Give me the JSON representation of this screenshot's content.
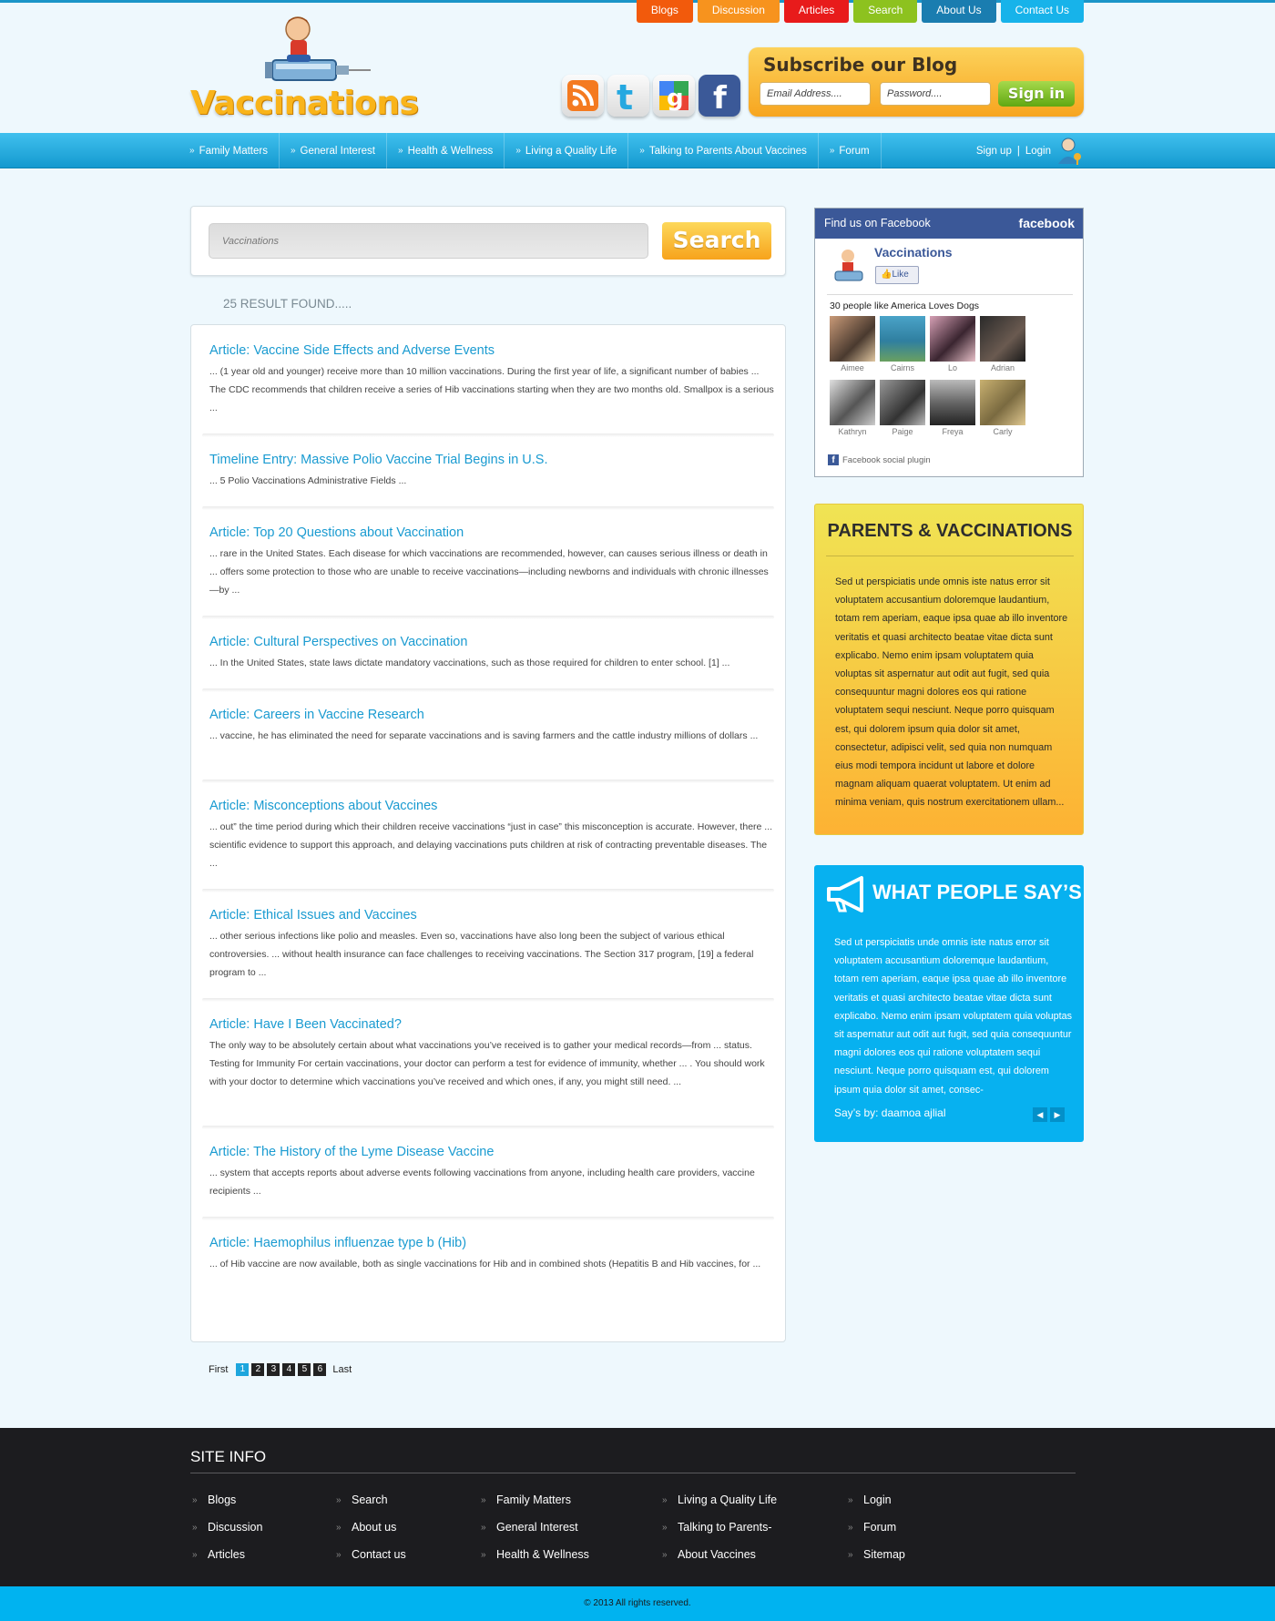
{
  "top_tabs": [
    {
      "label": "Blogs",
      "color": "#f25a0c"
    },
    {
      "label": "Discussion",
      "color": "#f7931e"
    },
    {
      "label": "Articles",
      "color": "#e81b1b"
    },
    {
      "label": "Search",
      "color": "#8dc21f"
    },
    {
      "label": "About Us",
      "color": "#1a7db0"
    },
    {
      "label": "Contact Us",
      "color": "#17b3ea"
    }
  ],
  "logo": {
    "text": "Vaccinations"
  },
  "social_icons": [
    "rss-icon",
    "twitter-icon",
    "google-icon",
    "facebook-icon"
  ],
  "subscribe": {
    "title": "Subscribe our Blog",
    "email_placeholder": "Email Address....",
    "password_placeholder": "Password....",
    "signin_label": "Sign in"
  },
  "nav": {
    "items": [
      "Family Matters",
      "General Interest",
      "Health & Wellness",
      "Living a Quality Life",
      "Talking to Parents About Vaccines",
      "Forum"
    ],
    "signup": "Sign up",
    "sep": "|",
    "login": "Login"
  },
  "search": {
    "value": "Vaccinations",
    "button": "Search"
  },
  "result_count": "25 RESULT FOUND.....",
  "results": [
    {
      "title": "Article: Vaccine Side Effects and Adverse Events",
      "snippet": "... (1 year old and younger) receive more than 10 million vaccinations. During the first year of life, a significant number of babies ... The CDC recommends that children receive a series of Hib vaccinations starting when they are two months old. Smallpox is a serious ..."
    },
    {
      "title": "Timeline Entry: Massive Polio Vaccine Trial Begins in U.S.",
      "snippet": "... 5 Polio Vaccinations Administrative Fields ..."
    },
    {
      "title": "Article: Top 20 Questions about Vaccination",
      "snippet": "... rare in the United States. Each disease for which vaccinations are recommended, however, can causes serious illness or death in ... offers some protection to those who are unable to receive vaccinations—including newborns and individuals with chronic illnesses—by ..."
    },
    {
      "title": "Article: Cultural Perspectives on Vaccination",
      "snippet": "... In the United States, state laws dictate mandatory vaccinations, such as those required for children to enter school. [1] ..."
    },
    {
      "title": "Article: Careers in Vaccine Research",
      "snippet": "... vaccine, he has eliminated the need for separate vaccinations and is saving farmers and the cattle industry millions of dollars ..."
    },
    {
      "title": "Article: Misconceptions about Vaccines",
      "snippet": "... out” the time period during which their children receive vaccinations “just in case” this misconception is accurate. However, there ... scientific evidence to support this approach, and delaying vaccinations puts children at risk of contracting preventable diseases. The ..."
    },
    {
      "title": "Article: Ethical Issues and Vaccines",
      "snippet": "... other serious infections like polio and measles. Even so, vaccinations have also long been the subject of various ethical controversies. ... without health insurance can face challenges to receiving vaccinations. The Section 317 program, [19] a federal program to ..."
    },
    {
      "title": "Article: Have I Been Vaccinated?",
      "snippet": "The only way to be absolutely certain about what vaccinations you’ve received is to gather your medical records—from ... status. Testing for Immunity For certain vaccinations, your doctor can perform a test for evidence of immunity, whether ... . You should work with your doctor to determine which vaccinations you’ve received and which ones, if any, you might still need. ..."
    },
    {
      "title": "Article: The History of the Lyme Disease Vaccine",
      "snippet": "... system that accepts reports about adverse events following vaccinations from anyone, including health care providers, vaccine recipients ..."
    },
    {
      "title": "Article: Haemophilus influenzae type b (Hib)",
      "snippet": "... of Hib vaccine are now available, both as single vaccinations for Hib and in combined shots (Hepatitis B and Hib vaccines, for ..."
    }
  ],
  "pagination": {
    "first": "First",
    "pages": [
      "1",
      "2",
      "3",
      "4",
      "5",
      "6"
    ],
    "current": "1",
    "last": "Last"
  },
  "facebook": {
    "header": "Find us on Facebook",
    "logo_text": "facebook",
    "page_name": "Vaccinations",
    "like_label": "Like",
    "people_text": "30 people like",
    "people_page": "America Loves Dogs",
    "people": [
      "Aimee",
      "Cairns",
      "Lo",
      "Adrian",
      "Kathryn",
      "Paige",
      "Freya",
      "Carly"
    ],
    "plugin_label": "Facebook social plugin"
  },
  "parents": {
    "title": "PARENTS & VACCINATIONS",
    "text": "Sed ut perspiciatis unde omnis iste natus error sit voluptatem accusantium doloremque laudantium, totam rem aperiam, eaque ipsa quae ab illo inventore veritatis et quasi architecto beatae vitae dicta sunt explicabo. Nemo enim ipsam voluptatem quia voluptas sit aspernatur aut odit aut fugit, sed quia consequuntur magni dolores eos qui ratione voluptatem sequi nesciunt. Neque porro quisquam est, qui dolorem ipsum quia dolor sit amet, consectetur, adipisci velit, sed quia non numquam eius modi tempora incidunt ut labore et dolore magnam aliquam quaerat voluptatem. Ut enim ad minima veniam, quis nostrum exercitationem ullam..."
  },
  "people_say": {
    "title": "WHAT PEOPLE SAY’S",
    "text": "Sed ut perspiciatis unde omnis iste natus error sit voluptatem accusantium doloremque laudantium, totam rem aperiam, eaque ipsa quae ab illo inventore veritatis et quasi architecto beatae vitae dicta sunt explicabo. Nemo enim ipsam voluptatem quia voluptas sit aspernatur aut odit aut fugit, sed quia consequuntur magni dolores eos qui ratione voluptatem sequi nesciunt. Neque porro quisquam est, qui dolorem ipsum quia dolor sit amet, consec-",
    "says_by": "Say’s by:  daamoa ajlial",
    "prev": "◀",
    "next": "▶"
  },
  "footer": {
    "title": "SITE INFO",
    "columns": [
      [
        "Blogs",
        "Discussion",
        "Articles"
      ],
      [
        "Search",
        "About us",
        "Contact us"
      ],
      [
        "Family Matters",
        "General Interest",
        "Health & Wellness"
      ],
      [
        "Living a Quality Life",
        "Talking to Parents-",
        "About Vaccines"
      ],
      [
        "Login",
        "Forum",
        "Sitemap"
      ]
    ],
    "copyright": "© 2013 All rights reserved."
  }
}
